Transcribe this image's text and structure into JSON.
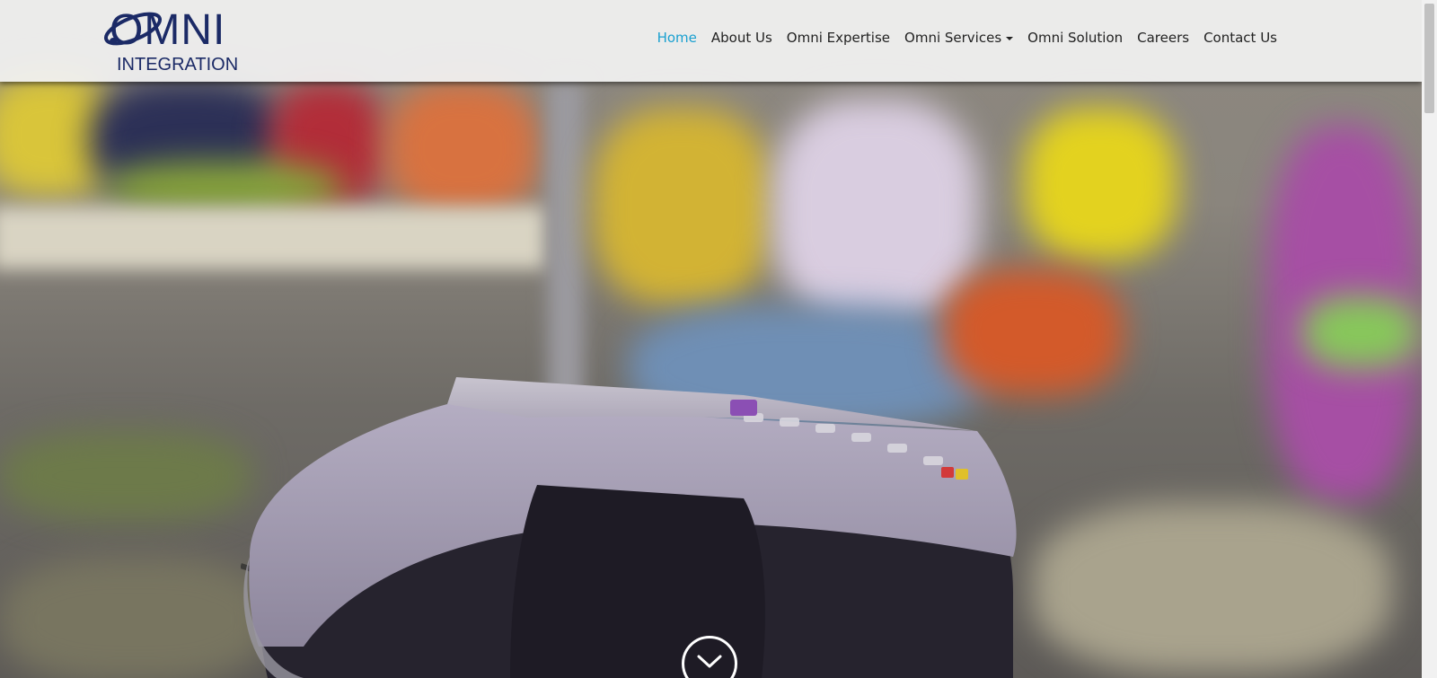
{
  "brand": {
    "logo_primary": "OMNI",
    "logo_secondary": "INTEGRATION",
    "logo_color": "#1b2a66"
  },
  "nav": {
    "items": [
      {
        "label": "Home",
        "active": true
      },
      {
        "label": "About Us",
        "active": false
      },
      {
        "label": "Omni Expertise",
        "active": false
      },
      {
        "label": "Omni Services",
        "active": false,
        "dropdown": true
      },
      {
        "label": "Omni Solution",
        "active": false
      },
      {
        "label": "Careers",
        "active": false
      },
      {
        "label": "Contact Us",
        "active": false
      }
    ],
    "active_color": "#1aa0d0"
  },
  "hero": {
    "scroll_icon": "chevron-down-icon"
  },
  "scrollbar": {
    "icon": "scrollbar-thumb"
  }
}
